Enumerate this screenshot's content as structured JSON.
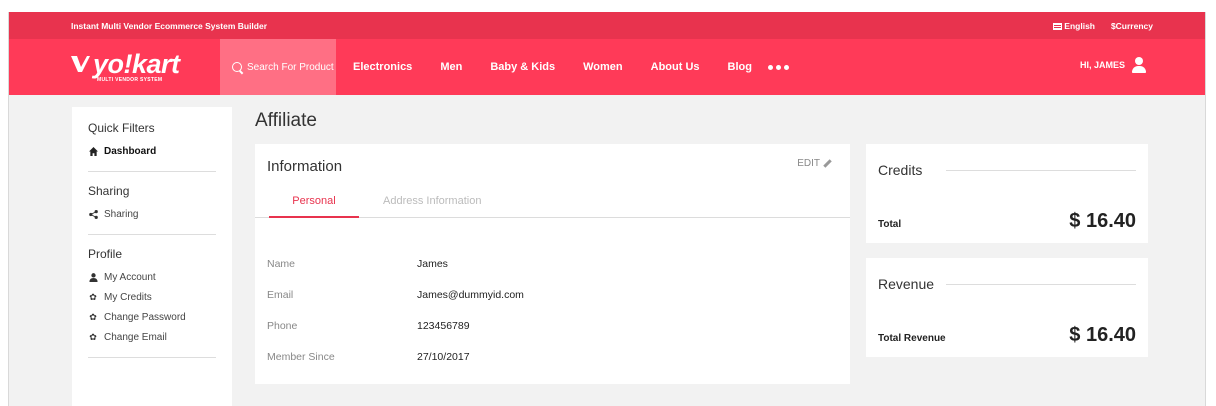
{
  "topbar": {
    "tagline": "Instant Multi Vendor Ecommerce System Builder",
    "language": "English",
    "currency": "$Currency"
  },
  "header": {
    "logo_text": "yo!kart",
    "logo_sub": "MULTI VENDOR SYSTEM",
    "search_placeholder": "Search For Product",
    "nav": [
      "Electronics",
      "Men",
      "Baby & Kids",
      "Women",
      "About Us",
      "Blog"
    ],
    "user_greeting": "HI, JAMES",
    "colors": {
      "primary": "#ff3a58",
      "strip": "#e8334e",
      "search_bg": "#ff6f84"
    }
  },
  "sidebar": {
    "sections": [
      {
        "heading": "Quick Filters",
        "items": [
          {
            "label": "Dashboard",
            "icon": "home-icon",
            "active": true
          }
        ]
      },
      {
        "heading": "Sharing",
        "items": [
          {
            "label": "Sharing",
            "icon": "share-icon"
          }
        ]
      },
      {
        "heading": "Profile",
        "items": [
          {
            "label": "My Account",
            "icon": "user-icon"
          },
          {
            "label": "My Credits",
            "icon": "gear-icon"
          },
          {
            "label": "Change Password",
            "icon": "gear-icon"
          },
          {
            "label": "Change Email",
            "icon": "gear-icon"
          }
        ]
      }
    ]
  },
  "main": {
    "page_title": "Affiliate",
    "info_card": {
      "title": "Information",
      "edit_label": "EDIT",
      "tabs": [
        "Personal",
        "Address Information"
      ],
      "active_tab": "Personal",
      "fields": [
        {
          "label": "Name",
          "value": "James"
        },
        {
          "label": "Email",
          "value": "James@dummyid.com"
        },
        {
          "label": "Phone",
          "value": "123456789"
        },
        {
          "label": "Member Since",
          "value": "27/10/2017"
        }
      ]
    }
  },
  "credits": {
    "title": "Credits",
    "label": "Total",
    "value": "$ 16.40"
  },
  "revenue": {
    "title": "Revenue",
    "label": "Total Revenue",
    "value": "$ 16.40"
  }
}
